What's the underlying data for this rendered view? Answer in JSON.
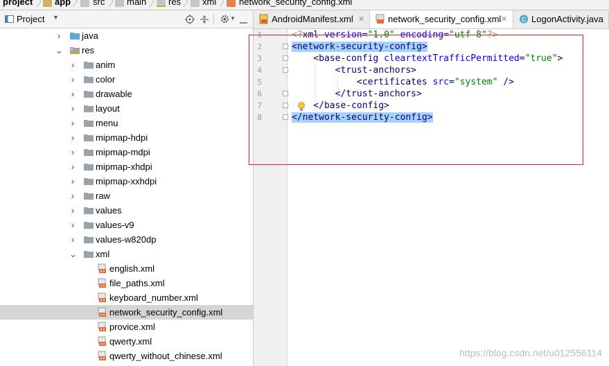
{
  "breadcrumb": {
    "items": [
      "project",
      "app",
      "src",
      "main",
      "res",
      "xml",
      "network_security_config.xml"
    ]
  },
  "project_panel": {
    "title": "Project",
    "tree": [
      {
        "label": "java",
        "depth": 1,
        "expanded": false,
        "type": "folder-java"
      },
      {
        "label": "res",
        "depth": 1,
        "expanded": true,
        "type": "folder-res"
      },
      {
        "label": "anim",
        "depth": 2,
        "expanded": false,
        "type": "folder"
      },
      {
        "label": "color",
        "depth": 2,
        "expanded": false,
        "type": "folder"
      },
      {
        "label": "drawable",
        "depth": 2,
        "expanded": false,
        "type": "folder"
      },
      {
        "label": "layout",
        "depth": 2,
        "expanded": false,
        "type": "folder"
      },
      {
        "label": "menu",
        "depth": 2,
        "expanded": false,
        "type": "folder"
      },
      {
        "label": "mipmap-hdpi",
        "depth": 2,
        "expanded": false,
        "type": "folder"
      },
      {
        "label": "mipmap-mdpi",
        "depth": 2,
        "expanded": false,
        "type": "folder"
      },
      {
        "label": "mipmap-xhdpi",
        "depth": 2,
        "expanded": false,
        "type": "folder"
      },
      {
        "label": "mipmap-xxhdpi",
        "depth": 2,
        "expanded": false,
        "type": "folder"
      },
      {
        "label": "raw",
        "depth": 2,
        "expanded": false,
        "type": "folder"
      },
      {
        "label": "values",
        "depth": 2,
        "expanded": false,
        "type": "folder"
      },
      {
        "label": "values-v9",
        "depth": 2,
        "expanded": false,
        "type": "folder"
      },
      {
        "label": "values-w820dp",
        "depth": 2,
        "expanded": false,
        "type": "folder"
      },
      {
        "label": "xml",
        "depth": 2,
        "expanded": true,
        "type": "folder"
      },
      {
        "label": "english.xml",
        "depth": 3,
        "type": "file"
      },
      {
        "label": "file_paths.xml",
        "depth": 3,
        "type": "file"
      },
      {
        "label": "keyboard_number.xml",
        "depth": 3,
        "type": "file"
      },
      {
        "label": "network_security_config.xml",
        "depth": 3,
        "type": "file",
        "selected": true
      },
      {
        "label": "provice.xml",
        "depth": 3,
        "type": "file"
      },
      {
        "label": "qwerty.xml",
        "depth": 3,
        "type": "file"
      },
      {
        "label": "qwerty_without_chinese.xml",
        "depth": 3,
        "type": "file"
      }
    ]
  },
  "tabs": [
    {
      "label": "AndroidManifest.xml",
      "active": false
    },
    {
      "label": "network_security_config.xml",
      "active": true
    },
    {
      "label": "LogonActivity.java",
      "active": false
    }
  ],
  "editor": {
    "line_numbers": [
      "1",
      "2",
      "3",
      "4",
      "5",
      "6",
      "7",
      "8"
    ],
    "lines": [
      {
        "text": "<?xml version=\"1.0\" encoding=\"utf-8\"?>"
      },
      {
        "text": "<network-security-config>"
      },
      {
        "text": "    <base-config cleartextTrafficPermitted=\"true\">"
      },
      {
        "text": "        <trust-anchors>"
      },
      {
        "text": "            <certificates src=\"system\" />"
      },
      {
        "text": "        </trust-anchors>"
      },
      {
        "text": "    </base-config>"
      },
      {
        "text": "</network-security-config>"
      }
    ]
  },
  "watermark": "https://blog.csdn.net/u012556114",
  "colors": {
    "selection": "#a6d2ff",
    "tag": "#000080",
    "attribute": "#0000ff",
    "string": "#008000",
    "annotation_box": "#e02020"
  }
}
